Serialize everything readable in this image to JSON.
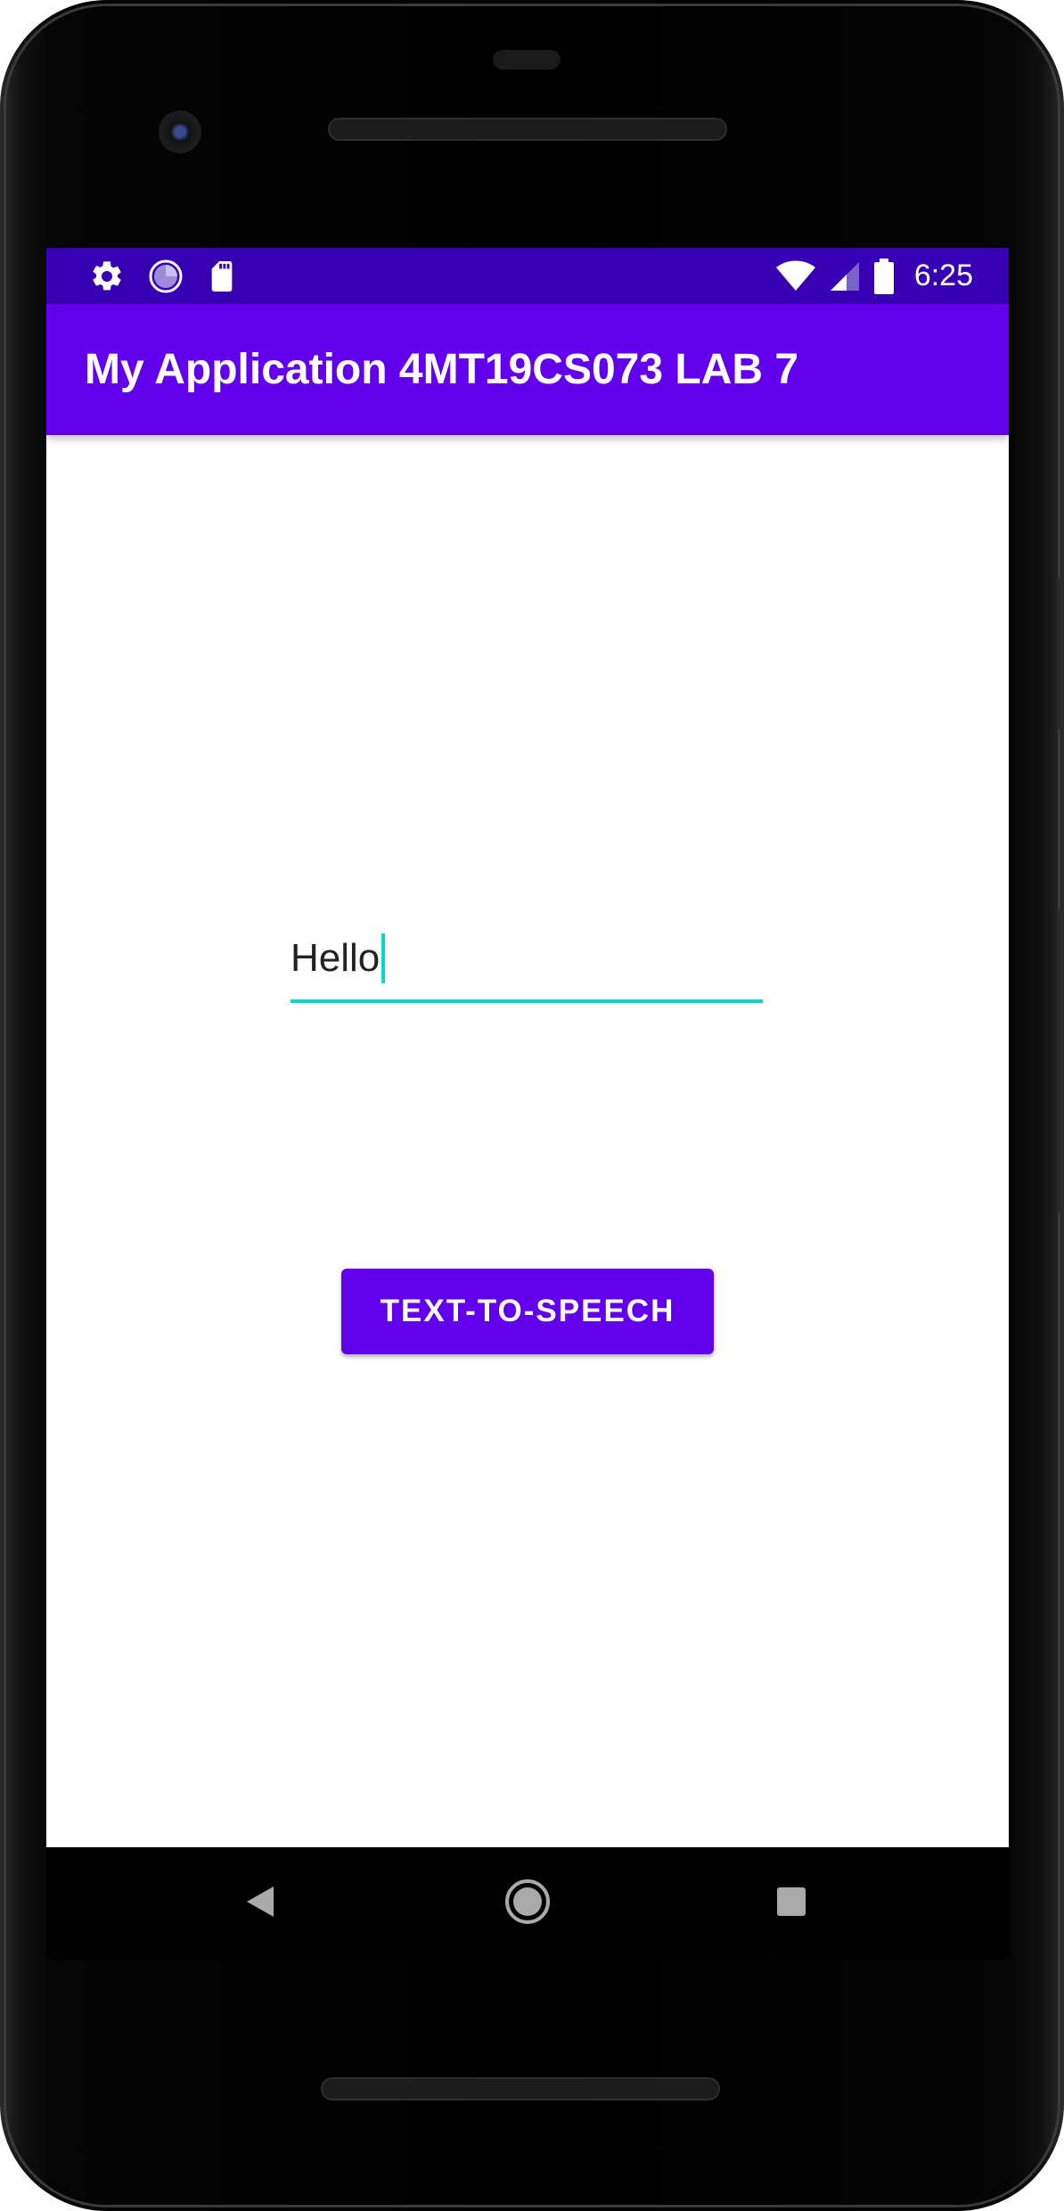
{
  "status_bar": {
    "time": "6:25",
    "left_icons": [
      "gear-icon",
      "sync-icon",
      "sd-card-icon"
    ],
    "right_icons": [
      "wifi-icon",
      "cell-signal-icon",
      "battery-icon"
    ]
  },
  "app_bar": {
    "title": "My Application 4MT19CS073 LAB 7"
  },
  "main": {
    "text_input": {
      "value": "Hello"
    },
    "tts_button": {
      "label": "TEXT-TO-SPEECH"
    }
  },
  "nav_bar": {
    "items": [
      "back-icon",
      "home-icon",
      "recents-icon"
    ]
  },
  "colors": {
    "status_bar": "#3700b3",
    "primary": "#6200ee",
    "accent": "#03dac5"
  }
}
